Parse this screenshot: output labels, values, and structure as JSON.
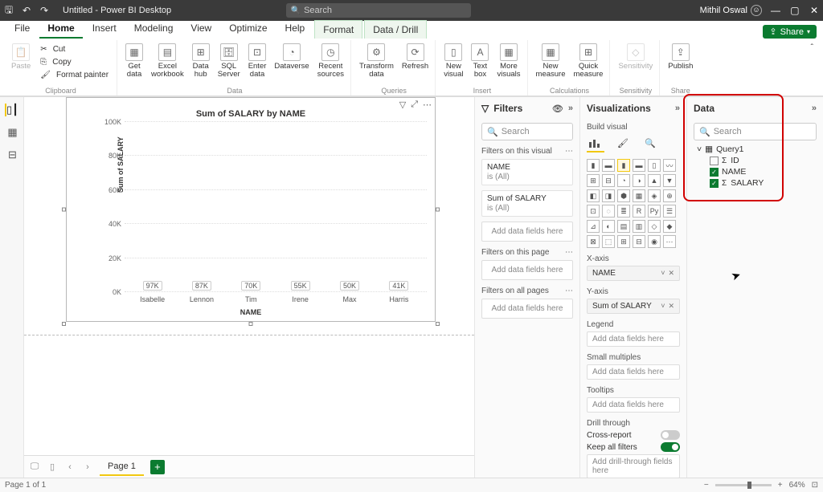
{
  "titlebar": {
    "app_title": "Untitled - Power BI Desktop",
    "search_placeholder": "Search",
    "user_name": "Mithil Oswal"
  },
  "menu": {
    "tabs": [
      "File",
      "Home",
      "Insert",
      "Modeling",
      "View",
      "Optimize",
      "Help",
      "Format",
      "Data / Drill"
    ],
    "active": "Home",
    "highlight": [
      "Format",
      "Data / Drill"
    ],
    "share": "Share"
  },
  "ribbon": {
    "clipboard": {
      "label": "Clipboard",
      "cut": "Cut",
      "copy": "Copy",
      "fmt": "Format painter",
      "paste": "Paste"
    },
    "data": {
      "label": "Data",
      "buttons": [
        "Get\ndata",
        "Excel\nworkbook",
        "Data\nhub",
        "SQL\nServer",
        "Enter\ndata",
        "Dataverse",
        "Recent\nsources"
      ]
    },
    "queries": {
      "label": "Queries",
      "buttons": [
        "Transform\ndata",
        "Refresh"
      ]
    },
    "insert": {
      "label": "Insert",
      "buttons": [
        "New\nvisual",
        "Text\nbox",
        "More\nvisuals"
      ]
    },
    "calc": {
      "label": "Calculations",
      "buttons": [
        "New\nmeasure",
        "Quick\nmeasure"
      ]
    },
    "sens": {
      "label": "Sensitivity",
      "button": "Sensitivity"
    },
    "share_g": {
      "label": "Share",
      "button": "Publish"
    }
  },
  "visual": {
    "title": "Sum of SALARY by NAME",
    "ytitle": "Sum of SALARY",
    "xtitle": "NAME"
  },
  "chart_data": {
    "type": "bar",
    "categories": [
      "Isabelle",
      "Lennon",
      "Tim",
      "Irene",
      "Max",
      "Harris"
    ],
    "values": [
      97000,
      87000,
      70000,
      55000,
      50000,
      41000
    ],
    "labels": [
      "97K",
      "87K",
      "70K",
      "55K",
      "50K",
      "41K"
    ],
    "yticks": [
      "0K",
      "20K",
      "40K",
      "60K",
      "80K",
      "100K"
    ],
    "ymax": 100000,
    "title": "Sum of SALARY by NAME",
    "xlabel": "NAME",
    "ylabel": "Sum of SALARY"
  },
  "filters": {
    "header": "Filters",
    "search": "Search",
    "on_visual": "Filters on this visual",
    "cards": [
      {
        "name": "NAME",
        "val": "is (All)"
      },
      {
        "name": "Sum of SALARY",
        "val": "is (All)"
      }
    ],
    "add": "Add data fields here",
    "on_page": "Filters on this page",
    "on_all": "Filters on all pages"
  },
  "viz": {
    "header": "Visualizations",
    "build": "Build visual",
    "xaxis": "X-axis",
    "xaxis_val": "NAME",
    "yaxis": "Y-axis",
    "yaxis_val": "Sum of SALARY",
    "legend": "Legend",
    "small": "Small multiples",
    "tooltips": "Tooltips",
    "add": "Add data fields here",
    "drill": "Drill through",
    "cross": "Cross-report",
    "keep": "Keep all filters",
    "adddrill": "Add drill-through fields here"
  },
  "data": {
    "header": "Data",
    "search": "Search",
    "table": "Query1",
    "fields": [
      {
        "name": "ID",
        "checked": false,
        "sigma": true
      },
      {
        "name": "NAME",
        "checked": true,
        "sigma": false
      },
      {
        "name": "SALARY",
        "checked": true,
        "sigma": true
      }
    ]
  },
  "pagebar": {
    "page": "Page 1"
  },
  "status": {
    "page": "Page 1 of 1",
    "zoom": "64%"
  }
}
